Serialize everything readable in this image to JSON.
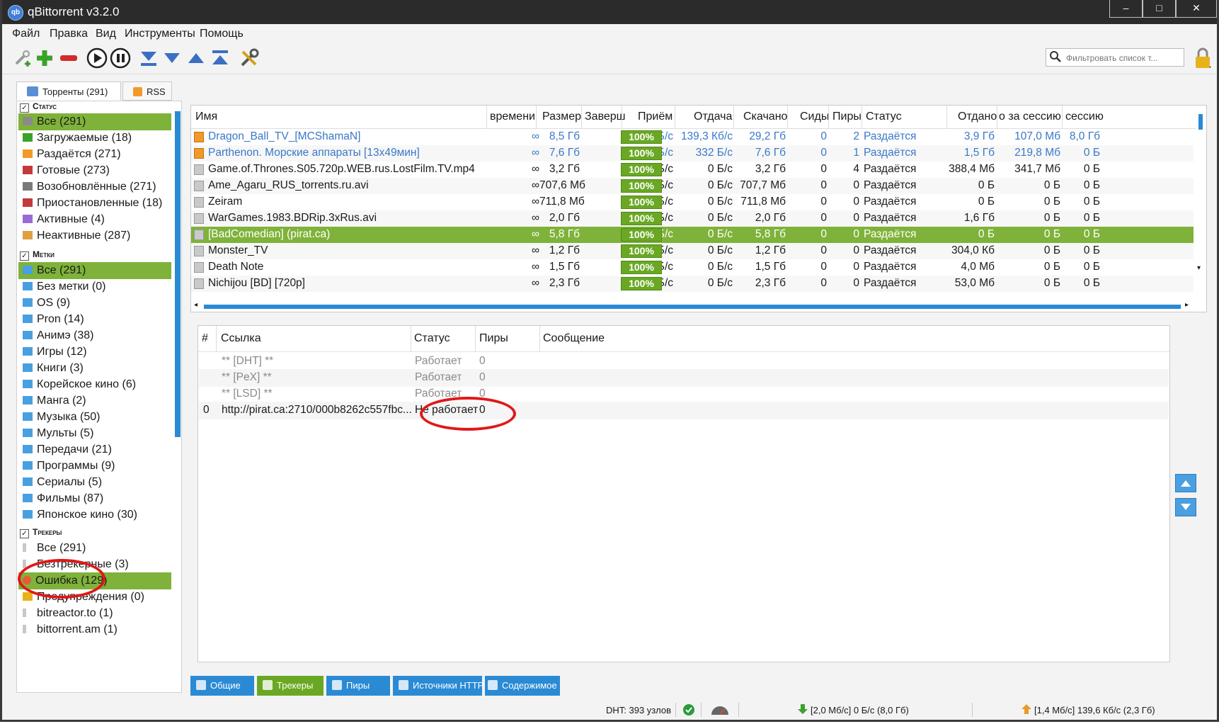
{
  "window": {
    "title": "qBittorrent v3.2.0",
    "app_icon": "qb"
  },
  "menu": [
    "Файл",
    "Правка",
    "Вид",
    "Инструменты",
    "Помощь"
  ],
  "search": {
    "placeholder": "Фильтровать список т..."
  },
  "tabs": [
    {
      "label": "Торренты (291)"
    },
    {
      "label": "RSS"
    }
  ],
  "sidebar": {
    "status_header": "Статус",
    "status_items": [
      "Все (291)",
      "Загружаемые (18)",
      "Раздаётся (271)",
      "Готовые (273)",
      "Возобновлённые (271)",
      "Приостановленные (18)",
      "Активные (4)",
      "Неактивные (287)"
    ],
    "labels_header": "Метки",
    "label_items": [
      "Все (291)",
      "Без метки (0)",
      "OS (9)",
      "Pron (14)",
      "Анимэ (38)",
      "Игры (12)",
      "Книги (3)",
      "Корейское кино (6)",
      "Манга (2)",
      "Музыка (50)",
      "Мульты (5)",
      "Передачи (21)",
      "Программы (9)",
      "Сериалы (5)",
      "Фильмы (87)",
      "Японское кино (30)"
    ],
    "trackers_header": "Трекеры",
    "tracker_items": [
      "Все (291)",
      "Безтрекерные (3)",
      "Ошибка (129)",
      "Предупреждения (0)",
      "bitreactor.to (1)",
      "bittorrent.am (1)"
    ]
  },
  "torrents": {
    "columns": [
      "Имя",
      "времени",
      "Размер",
      "Заверш",
      "Приём",
      "Отдача",
      "Скачано",
      "Сиды",
      "Пиры",
      "Статус",
      "Отдано",
      "о за сессию",
      "сессию"
    ],
    "rows": [
      {
        "name": "Dragon_Ball_TV_[MCShamaN]",
        "eta": "∞",
        "size": "8,5 Гб",
        "done": "100%",
        "down": "0 Б/с",
        "up": "139,3 Кб/с",
        "downloaded": "29,2 Гб",
        "seeds": "0",
        "peers": "2",
        "status": "Раздаётся",
        "uploaded": "3,9 Гб",
        "up_session": "107,0 Мб",
        "session": "8,0 Гб"
      },
      {
        "name": "Parthenon. Морские аппараты [13x49мин]",
        "eta": "∞",
        "size": "7,6 Гб",
        "done": "100%",
        "down": "0 Б/с",
        "up": "332 Б/с",
        "downloaded": "7,6 Гб",
        "seeds": "0",
        "peers": "1",
        "status": "Раздаётся",
        "uploaded": "1,5 Гб",
        "up_session": "219,8 Мб",
        "session": "0 Б"
      },
      {
        "name": "Game.of.Thrones.S05.720p.WEB.rus.LostFilm.TV.mp4",
        "eta": "∞",
        "size": "3,2 Гб",
        "done": "100%",
        "down": "0 Б/с",
        "up": "0 Б/с",
        "downloaded": "3,2 Гб",
        "seeds": "0",
        "peers": "4",
        "status": "Раздаётся",
        "uploaded": "388,4 Мб",
        "up_session": "341,7 Мб",
        "session": "0 Б"
      },
      {
        "name": "Ame_Agaru_RUS_torrents.ru.avi",
        "eta": "∞",
        "size": "707,6 Мб",
        "done": "100%",
        "down": "0 Б/с",
        "up": "0 Б/с",
        "downloaded": "707,7 Мб",
        "seeds": "0",
        "peers": "0",
        "status": "Раздаётся",
        "uploaded": "0 Б",
        "up_session": "0 Б",
        "session": "0 Б"
      },
      {
        "name": "Zeiram",
        "eta": "∞",
        "size": "711,8 Мб",
        "done": "100%",
        "down": "0 Б/с",
        "up": "0 Б/с",
        "downloaded": "711,8 Мб",
        "seeds": "0",
        "peers": "0",
        "status": "Раздаётся",
        "uploaded": "0 Б",
        "up_session": "0 Б",
        "session": "0 Б"
      },
      {
        "name": "WarGames.1983.BDRip.3xRus.avi",
        "eta": "∞",
        "size": "2,0 Гб",
        "done": "100%",
        "down": "0 Б/с",
        "up": "0 Б/с",
        "downloaded": "2,0 Гб",
        "seeds": "0",
        "peers": "0",
        "status": "Раздаётся",
        "uploaded": "1,6 Гб",
        "up_session": "0 Б",
        "session": "0 Б"
      },
      {
        "name": "[BadComedian] (pirat.ca)",
        "eta": "∞",
        "size": "5,8 Гб",
        "done": "100%",
        "down": "0 Б/с",
        "up": "0 Б/с",
        "downloaded": "5,8 Гб",
        "seeds": "0",
        "peers": "0",
        "status": "Раздаётся",
        "uploaded": "0 Б",
        "up_session": "0 Б",
        "session": "0 Б"
      },
      {
        "name": "Monster_TV",
        "eta": "∞",
        "size": "1,2 Гб",
        "done": "100%",
        "down": "0 Б/с",
        "up": "0 Б/с",
        "downloaded": "1,2 Гб",
        "seeds": "0",
        "peers": "0",
        "status": "Раздаётся",
        "uploaded": "304,0 Кб",
        "up_session": "0 Б",
        "session": "0 Б"
      },
      {
        "name": "Death Note",
        "eta": "∞",
        "size": "1,5 Гб",
        "done": "100%",
        "down": "0 Б/с",
        "up": "0 Б/с",
        "downloaded": "1,5 Гб",
        "seeds": "0",
        "peers": "0",
        "status": "Раздаётся",
        "uploaded": "4,0 Мб",
        "up_session": "0 Б",
        "session": "0 Б"
      },
      {
        "name": "Nichijou [BD] [720p]",
        "eta": "∞",
        "size": "2,3 Гб",
        "done": "100%",
        "down": "0 Б/с",
        "up": "0 Б/с",
        "downloaded": "2,3 Гб",
        "seeds": "0",
        "peers": "0",
        "status": "Раздаётся",
        "uploaded": "53,0 Мб",
        "up_session": "0 Б",
        "session": "0 Б"
      }
    ]
  },
  "trackers": {
    "columns": [
      "#",
      "Ссылка",
      "Статус",
      "Пиры",
      "Сообщение"
    ],
    "rows": [
      {
        "num": "",
        "url": "** [DHT] **",
        "status": "Работает",
        "peers": "0",
        "message": ""
      },
      {
        "num": "",
        "url": "** [PeX] **",
        "status": "Работает",
        "peers": "0",
        "message": ""
      },
      {
        "num": "",
        "url": "** [LSD] **",
        "status": "Работает",
        "peers": "0",
        "message": ""
      },
      {
        "num": "0",
        "url": "http://pirat.ca:2710/000b8262c557fbc...",
        "status": "Не работает",
        "peers": "0",
        "message": ""
      }
    ]
  },
  "bottom_tabs": [
    "Общие",
    "Трекеры",
    "Пиры",
    "Источники HTTP",
    "Содержимое"
  ],
  "statusbar": {
    "dht": "DHT: 393 узлов",
    "download": "[2,0 Мб/с] 0 Б/с (8,0 Гб)",
    "upload": "[1,4 Мб/с] 139,6 Кб/с (2,3 Гб)"
  },
  "colors": {
    "accent_green": "#7fb23a",
    "accent_blue": "#2a8ad4",
    "highlight_red": "#e01818"
  }
}
